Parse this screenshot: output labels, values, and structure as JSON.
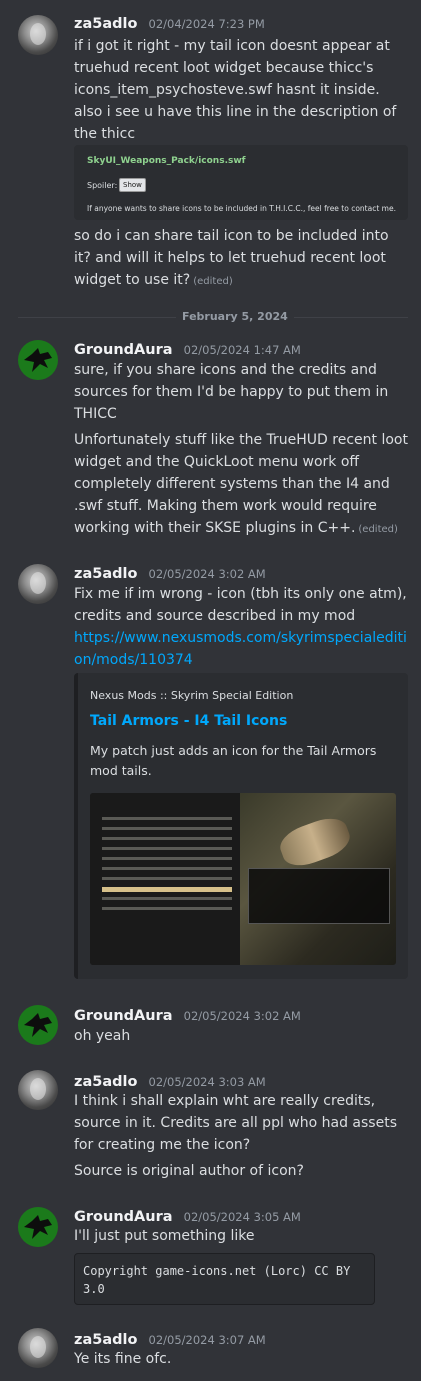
{
  "messages": [
    {
      "author": "za5adlo",
      "timestamp": "02/04/2024 7:23 PM",
      "lines": [
        "if i got it right - my tail icon doesnt appear at truehud recent loot widget because thicc's icons_item_psychosteve.swf hasnt it inside. also i see u have this line in the description of the thicc"
      ],
      "quote": {
        "title": "SkyUI_Weapons_Pack/icons.swf",
        "spoiler_label": "Spoiler:",
        "button_label": "Show",
        "body": "If anyone wants to share icons to be included in T.H.I.C.C., feel free to contact me."
      },
      "after": "so do i can share tail icon to be included into it? and will it helps to let truehud recent loot widget to use it?",
      "edited": "(edited)"
    },
    {
      "author": "GroundAura",
      "timestamp": "02/05/2024 1:47 AM",
      "p1": "sure, if you share icons and the credits and sources for them I'd be happy to put them in THICC",
      "p2": "Unfortunately stuff like the TrueHUD recent loot widget and the QuickLoot menu work off completely different systems than the I4 and .swf stuff. Making them work would require working with their SKSE plugins in C++.",
      "edited": "(edited)"
    },
    {
      "author": "za5adlo",
      "timestamp": "02/05/2024 3:02 AM",
      "text": "Fix me if im wrong - icon (tbh its only one atm), credits and source described in my mod",
      "link": "https://www.nexusmods.com/skyrimspecialedition/mods/110374",
      "embed": {
        "provider": "Nexus Mods :: Skyrim Special Edition",
        "title": "Tail Armors - I4 Tail Icons",
        "description": "My patch just adds an icon for the Tail Armors mod tails."
      }
    },
    {
      "author": "GroundAura",
      "timestamp": "02/05/2024 3:02 AM",
      "text": "oh yeah"
    },
    {
      "author": "za5adlo",
      "timestamp": "02/05/2024 3:03 AM",
      "p1": "I think i shall explain wht are really credits, source in it. Credits are all ppl who had assets for creating me the icon?",
      "p2": "Source is original author of icon?"
    },
    {
      "author": "GroundAura",
      "timestamp": "02/05/2024 3:05 AM",
      "text": "I'll just put something like",
      "code": "Copyright game-icons.net (Lorc) CC BY 3.0"
    },
    {
      "author": "za5adlo",
      "timestamp": "02/05/2024 3:07 AM",
      "text": "Ye its fine ofc."
    }
  ],
  "date_divider": "February 5, 2024",
  "colors": {
    "background": "#313338",
    "link": "#00a8fc",
    "embed_bg": "#2b2d31",
    "groundaura_avatar": "#1b7a1b"
  }
}
